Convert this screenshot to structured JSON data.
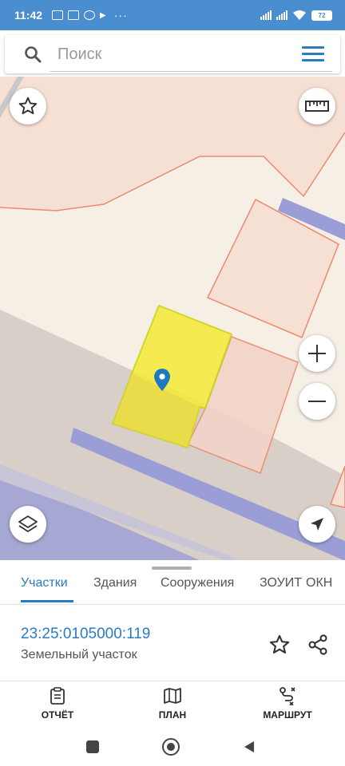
{
  "status_bar": {
    "time": "11:42",
    "more": "···",
    "battery": "72"
  },
  "search": {
    "placeholder": "Поиск"
  },
  "colors": {
    "accent": "#2a7cc0",
    "status_bar": "#4a8ed0",
    "parcel_fill": "#f5ea3c",
    "parcel_outline": "#e8734f",
    "road": "#9b9ed6",
    "map_background": "#f5efe6"
  },
  "map": {
    "icons": [
      "star-icon",
      "ruler-icon",
      "zoom-in-icon",
      "zoom-out-icon",
      "layers-icon",
      "navigation-arrow-icon",
      "location-pin-icon"
    ]
  },
  "tabs": [
    {
      "label": "Участки",
      "active": true
    },
    {
      "label": "Здания",
      "active": false
    },
    {
      "label": "Сооружения",
      "active": false
    },
    {
      "label": "ЗОУИТ",
      "active": false
    },
    {
      "label": "ОКН",
      "active": false
    }
  ],
  "parcel": {
    "number": "23:25:0105000:119",
    "type": "Земельный участок"
  },
  "bottom_nav": [
    {
      "label": "ОТЧЁТ",
      "icon": "report-icon"
    },
    {
      "label": "ПЛАН",
      "icon": "map-plan-icon"
    },
    {
      "label": "МАРШРУТ",
      "icon": "route-icon"
    }
  ]
}
